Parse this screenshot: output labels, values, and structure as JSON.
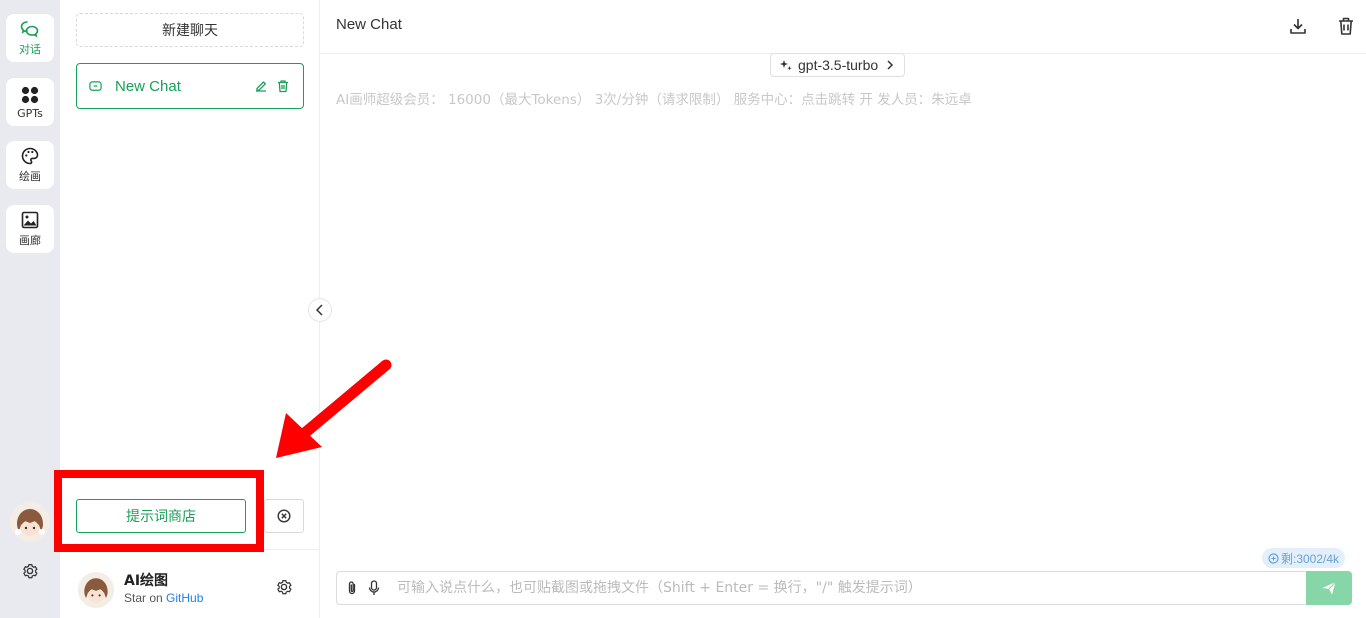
{
  "rail": {
    "items": [
      {
        "label": "对话",
        "icon": "chat-bubbles-icon"
      },
      {
        "label": "GPTs",
        "icon": "grid-dots-icon"
      },
      {
        "label": "绘画",
        "icon": "palette-icon"
      },
      {
        "label": "画廊",
        "icon": "image-icon"
      }
    ]
  },
  "sidebar": {
    "new_chat_label": "新建聊天",
    "chats": [
      {
        "title": "New Chat"
      }
    ],
    "prompt_store_label": "提示词商店",
    "footer": {
      "name": "AI绘图",
      "sub_prefix": "Star on",
      "sub_link": "GitHub"
    }
  },
  "main": {
    "title": "New Chat",
    "model": "gpt-3.5-turbo",
    "notice": "AI画师超级会员： 16000（最大Tokens） 3次/分钟（请求限制） 服务中心：点击跳转 开 发人员：朱远卓",
    "remaining": "剩:3002/4k",
    "input_placeholder": "可输入说点什么，也可贴截图或拖拽文件（Shift + Enter = 换行，\"/\" 触发提示词）"
  },
  "colors": {
    "accent": "#18a058",
    "highlight": "#ff0000",
    "rail_bg": "#e8eaf0"
  }
}
